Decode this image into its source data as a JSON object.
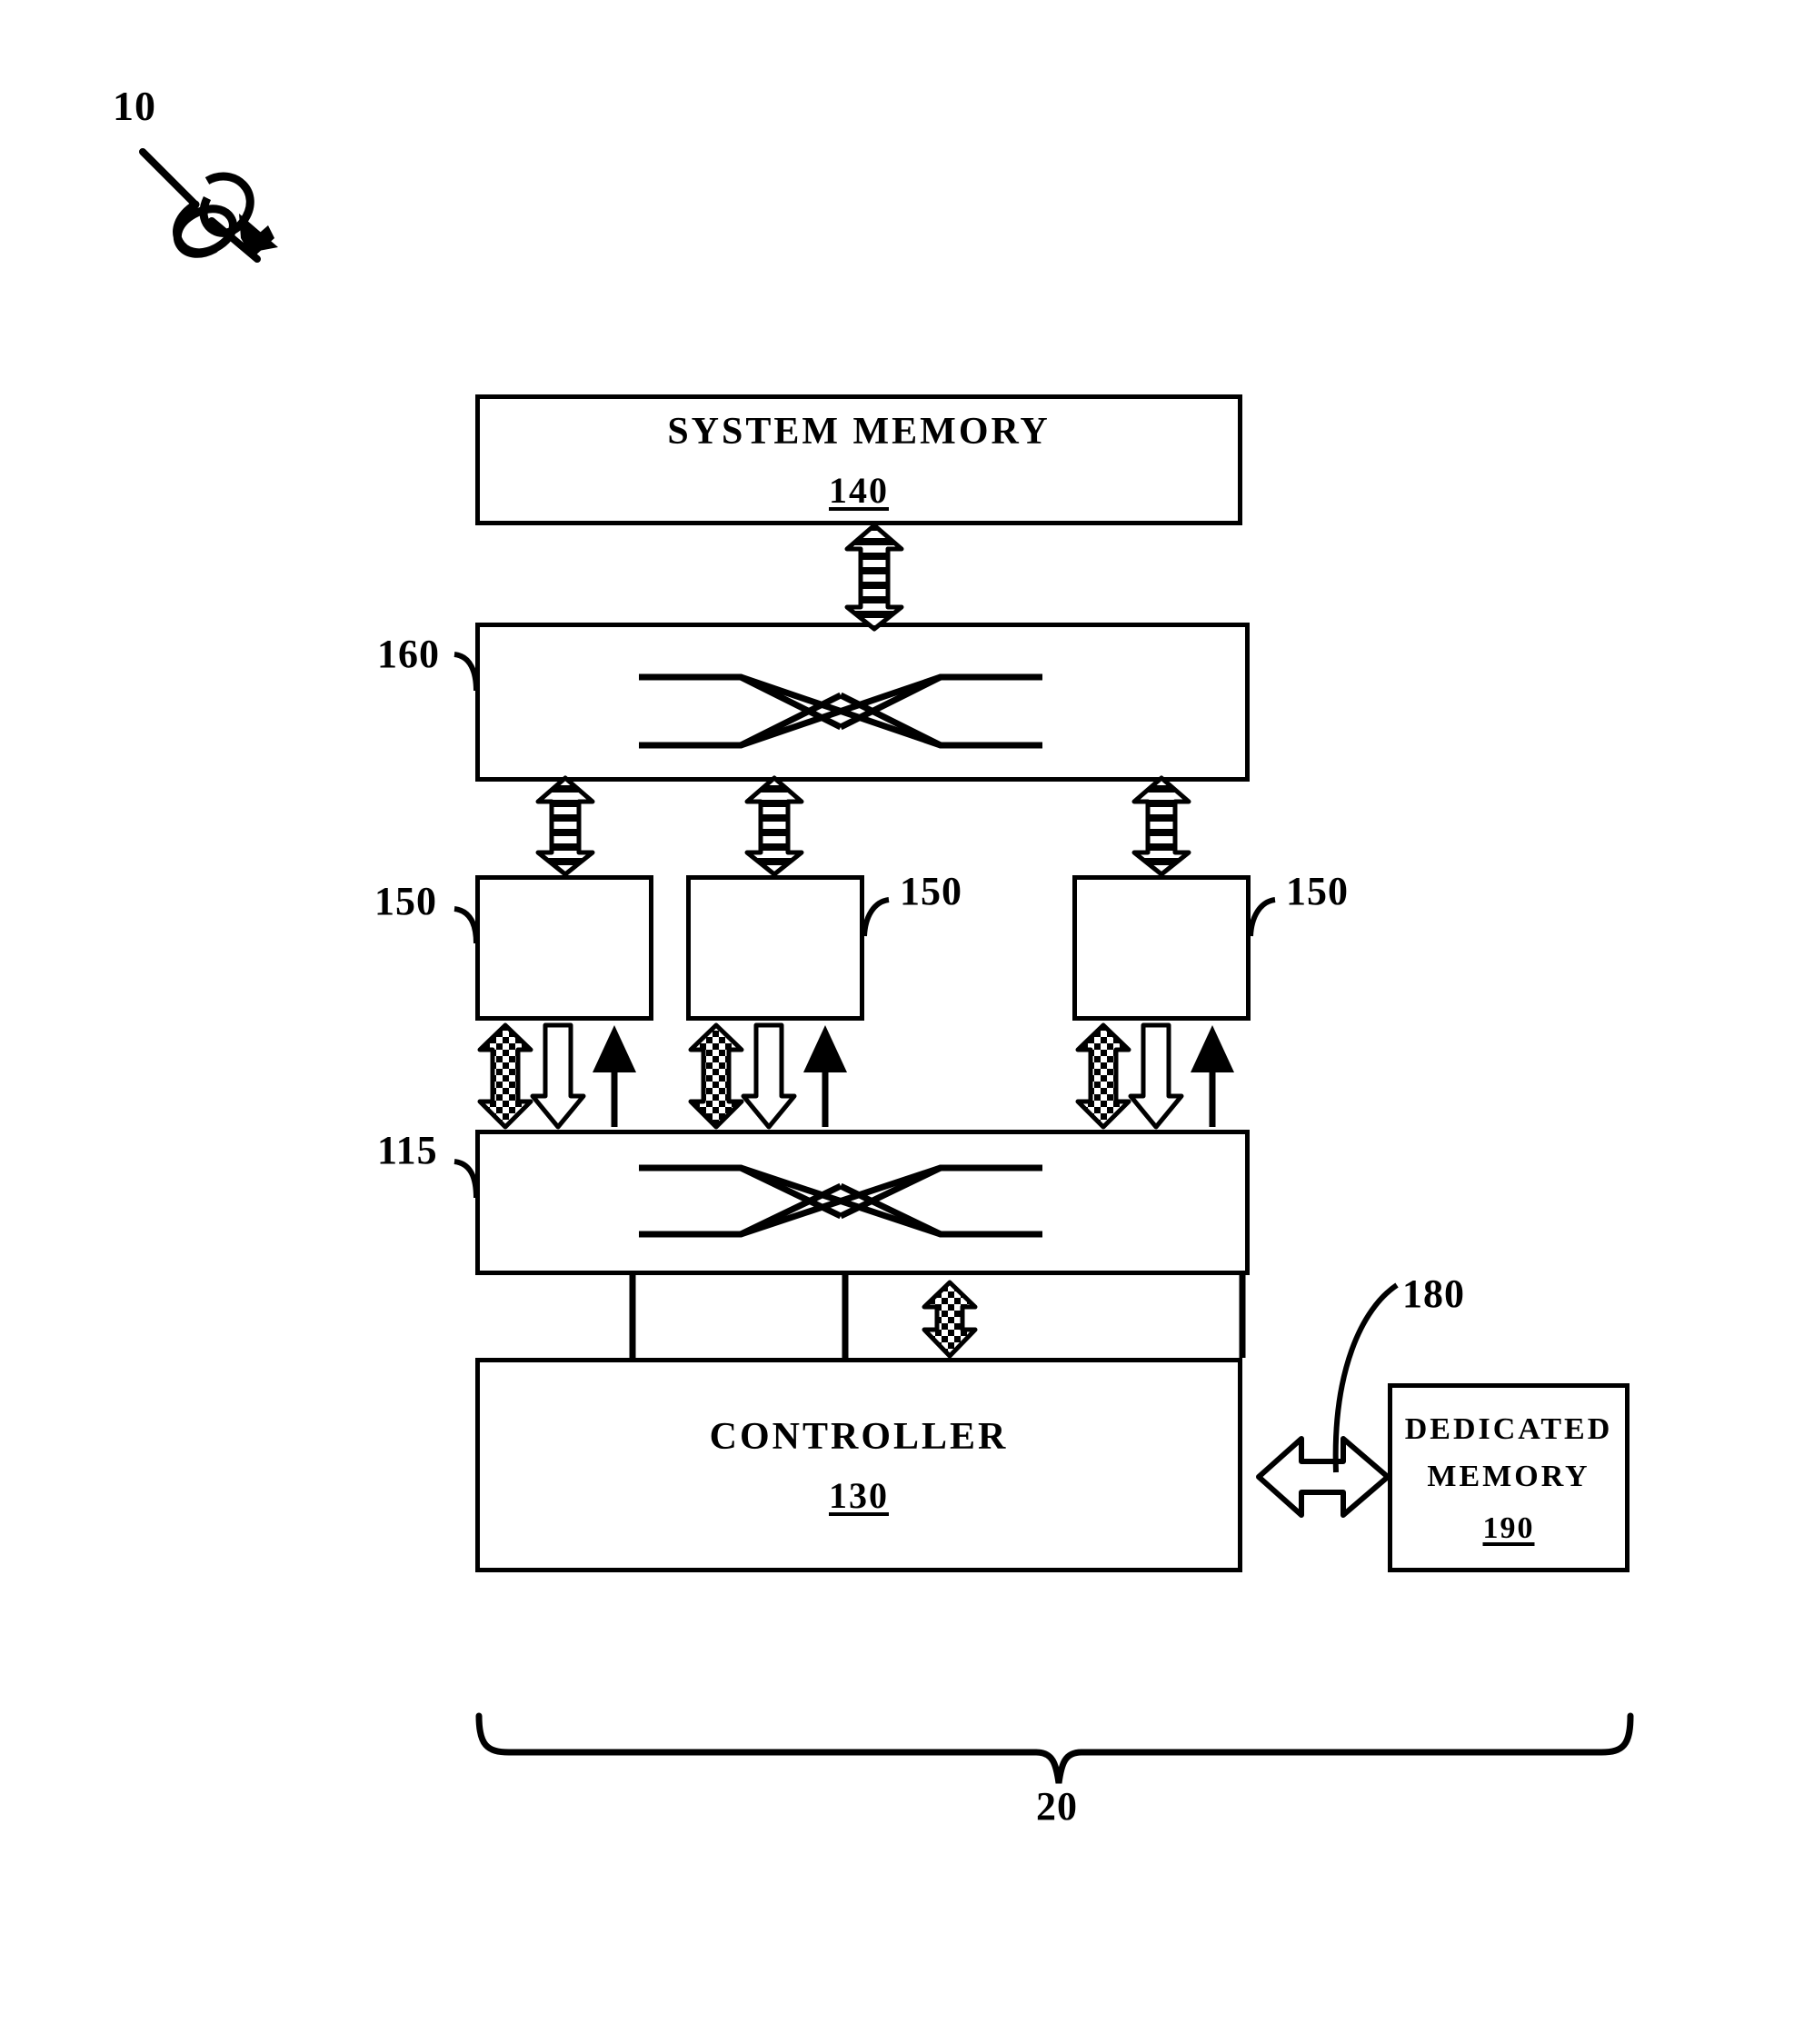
{
  "figure": {
    "system_ref": "10",
    "assembly_ref": "20"
  },
  "blocks": {
    "system_memory": {
      "title": "SYSTEM MEMORY",
      "number": "140"
    },
    "upper_crossbar": {
      "ref": "160"
    },
    "processing_units": [
      {
        "ref": "150"
      },
      {
        "ref": "150"
      },
      {
        "ref": "150"
      }
    ],
    "lower_crossbar": {
      "ref": "115"
    },
    "controller": {
      "title": "CONTROLLER",
      "number": "130"
    },
    "dedicated_memory": {
      "title_line1": "DEDICATED",
      "title_line2": "MEMORY",
      "number": "190"
    },
    "memory_link": {
      "ref": "180"
    }
  },
  "colors": {
    "ink": "#000000",
    "paper": "#ffffff"
  }
}
